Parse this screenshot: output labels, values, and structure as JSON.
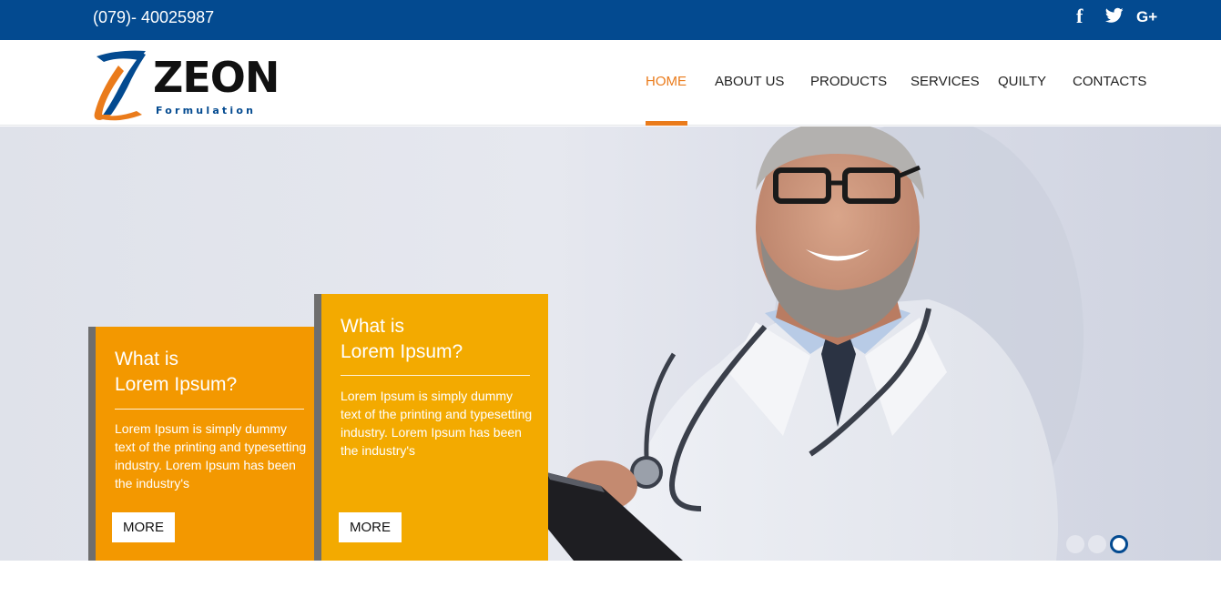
{
  "topbar": {
    "phone": "(079)- 40025987",
    "social": [
      {
        "icon": "facebook-icon",
        "glyph": "f"
      },
      {
        "icon": "twitter-icon",
        "glyph": ""
      },
      {
        "icon": "google-plus-icon",
        "glyph": "G+"
      }
    ],
    "background": "#034a90"
  },
  "logo": {
    "name": "ZEON",
    "tagline": "Formulation",
    "colors": {
      "blue": "#034a90",
      "orange": "#ea7b1b"
    }
  },
  "nav": {
    "items": [
      "HOME",
      "ABOUT US",
      "PRODUCTS",
      "SERVICES",
      "QUILTY",
      "CONTACTS"
    ],
    "active": "HOME",
    "active_color": "#ea7b1b"
  },
  "hero": {
    "cards": [
      {
        "title_line1": "What is",
        "title_line2": "Lorem Ipsum?",
        "body": "Lorem Ipsum is simply dummy text of the printing and typesetting industry. Lorem Ipsum has been the industry's",
        "button": "MORE",
        "color": "#f39800"
      },
      {
        "title_line1": "What is",
        "title_line2": "Lorem Ipsum?",
        "body": "Lorem Ipsum is simply dummy text of the printing and typesetting industry. Lorem Ipsum has been the industry's",
        "button": "MORE",
        "color": "#f3aa00"
      }
    ],
    "slider": {
      "count": 3,
      "active_index": 3
    }
  }
}
